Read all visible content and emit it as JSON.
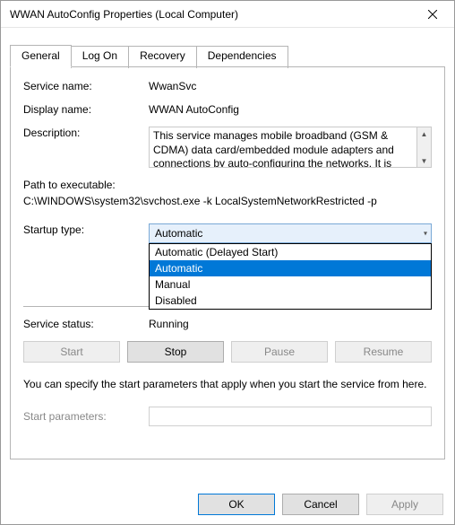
{
  "window": {
    "title": "WWAN AutoConfig Properties (Local Computer)"
  },
  "tabs": {
    "general": "General",
    "logon": "Log On",
    "recovery": "Recovery",
    "dependencies": "Dependencies"
  },
  "general": {
    "service_name_label": "Service name:",
    "service_name": "WwanSvc",
    "display_name_label": "Display name:",
    "display_name": "WWAN AutoConfig",
    "description_label": "Description:",
    "description": "This service manages mobile broadband (GSM & CDMA) data card/embedded module adapters and connections by auto-configuring the networks. It is",
    "path_label": "Path to executable:",
    "path": "C:\\WINDOWS\\system32\\svchost.exe -k LocalSystemNetworkRestricted -p",
    "startup_type_label": "Startup type:",
    "startup_selected": "Automatic",
    "startup_options": {
      "delayed": "Automatic (Delayed Start)",
      "automatic": "Automatic",
      "manual": "Manual",
      "disabled": "Disabled"
    },
    "service_status_label": "Service status:",
    "service_status": "Running",
    "buttons": {
      "start": "Start",
      "stop": "Stop",
      "pause": "Pause",
      "resume": "Resume"
    },
    "help_text": "You can specify the start parameters that apply when you start the service from here.",
    "start_params_label": "Start parameters:",
    "start_params_value": ""
  },
  "dialog_buttons": {
    "ok": "OK",
    "cancel": "Cancel",
    "apply": "Apply"
  }
}
